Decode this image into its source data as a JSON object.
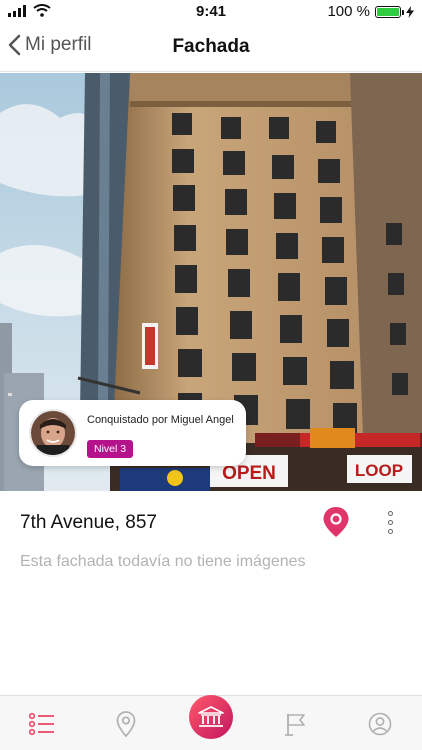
{
  "status_bar": {
    "time": "9:41",
    "battery": "100 %",
    "battery_level": 1.0,
    "icons": [
      "signal-icon",
      "wifi-icon",
      "battery-icon",
      "charging-icon"
    ]
  },
  "nav": {
    "back_label": "Mi perfil",
    "title": "Fachada"
  },
  "conquered": {
    "text": "Conquistado por Miguel Angel",
    "level": "Nivel 3"
  },
  "building": {
    "address": "7th Avenue, 857",
    "empty_message": "Esta fachada todavía no tiene imágenes",
    "photo_signs": [
      "OPEN",
      "LOOP"
    ]
  },
  "tabbar": {
    "items": [
      "list-icon",
      "map-pin-icon",
      "building-icon",
      "flag-icon",
      "profile-icon"
    ],
    "active": "building-icon"
  },
  "colors": {
    "accent": "#b5138c",
    "pin": "#e0356b",
    "tab_active": "#e84a6a",
    "tab_inactive": "#b0b0b0",
    "battery": "#2ecc40"
  }
}
